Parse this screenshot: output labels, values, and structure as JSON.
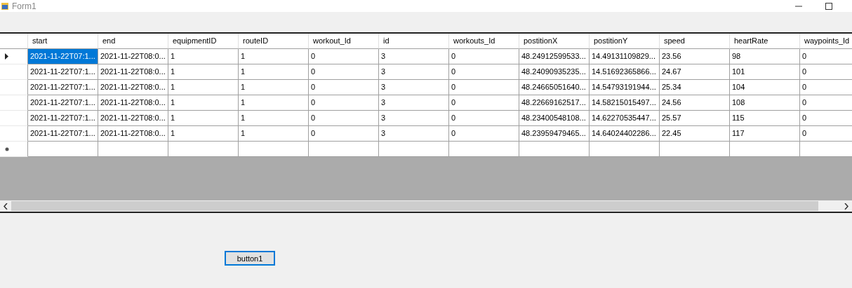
{
  "window": {
    "title": "Form1"
  },
  "grid": {
    "columns": [
      "start",
      "end",
      "equipmentID",
      "routeID",
      "workout_Id",
      "id",
      "workouts_Id",
      "postitionX",
      "postitionY",
      "speed",
      "heartRate",
      "waypoints_Id"
    ],
    "rows": [
      {
        "current": true,
        "cells": [
          "2021-11-22T07:1...",
          "2021-11-22T08:0...",
          "1",
          "1",
          "0",
          "3",
          "0",
          "48.24912599533...",
          "14.49131109829...",
          "23.56",
          "98",
          "0"
        ]
      },
      {
        "current": false,
        "cells": [
          "2021-11-22T07:1...",
          "2021-11-22T08:0...",
          "1",
          "1",
          "0",
          "3",
          "0",
          "48.24090935235...",
          "14.51692365866...",
          "24.67",
          "101",
          "0"
        ]
      },
      {
        "current": false,
        "cells": [
          "2021-11-22T07:1...",
          "2021-11-22T08:0...",
          "1",
          "1",
          "0",
          "3",
          "0",
          "48.24665051640...",
          "14.54793191944...",
          "25.34",
          "104",
          "0"
        ]
      },
      {
        "current": false,
        "cells": [
          "2021-11-22T07:1...",
          "2021-11-22T08:0...",
          "1",
          "1",
          "0",
          "3",
          "0",
          "48.22669162517...",
          "14.58215015497...",
          "24.56",
          "108",
          "0"
        ]
      },
      {
        "current": false,
        "cells": [
          "2021-11-22T07:1...",
          "2021-11-22T08:0...",
          "1",
          "1",
          "0",
          "3",
          "0",
          "48.23400548108...",
          "14.62270535447...",
          "25.57",
          "115",
          "0"
        ]
      },
      {
        "current": false,
        "cells": [
          "2021-11-22T07:1...",
          "2021-11-22T08:0...",
          "1",
          "1",
          "0",
          "3",
          "0",
          "48.23959479465...",
          "14.64024402286...",
          "22.45",
          "117",
          "0"
        ]
      }
    ],
    "new_row": true
  },
  "buttons": [
    {
      "label": "button1",
      "focused": true
    }
  ]
}
